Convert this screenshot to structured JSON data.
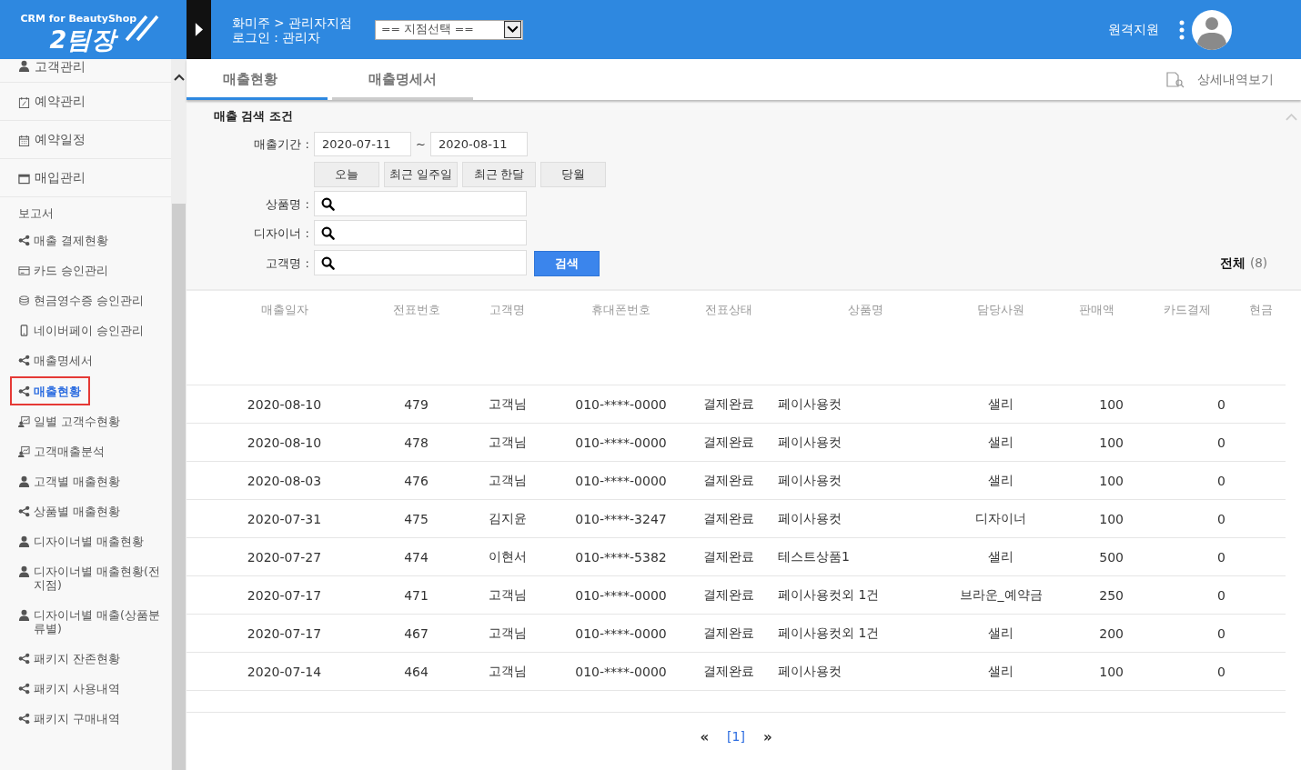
{
  "header": {
    "logo": {
      "tagline": "CRM for BeautyShop",
      "name": "2팀장"
    },
    "breadcrumb": "화미주 > 관리자지점",
    "login": "로그인 : 관리자",
    "branch_select": {
      "value": "== 지점선택 =="
    },
    "remote_support": "원격지원"
  },
  "sidebar": {
    "items": [
      {
        "kind": "item",
        "label": "고객관리",
        "selected": false
      },
      {
        "kind": "item",
        "label": "예약관리",
        "selected": false
      },
      {
        "kind": "item",
        "label": "예약일정",
        "selected": false
      },
      {
        "kind": "item",
        "label": "매입관리",
        "selected": false
      },
      {
        "kind": "section",
        "label": "보고서"
      },
      {
        "kind": "sub",
        "label": "매출 결제현황",
        "selected": false
      },
      {
        "kind": "sub",
        "label": "카드 승인관리",
        "selected": false
      },
      {
        "kind": "sub",
        "label": "현금영수증 승인관리",
        "selected": false
      },
      {
        "kind": "sub",
        "label": "네이버페이 승인관리",
        "selected": false
      },
      {
        "kind": "sub",
        "label": "매출명세서",
        "selected": false
      },
      {
        "kind": "sub",
        "label": "매출현황",
        "selected": true
      },
      {
        "kind": "sub",
        "label": "일별 고객수현황",
        "selected": false
      },
      {
        "kind": "sub",
        "label": "고객매출분석",
        "selected": false
      },
      {
        "kind": "sub",
        "label": "고객별 매출현황",
        "selected": false
      },
      {
        "kind": "sub",
        "label": "상품별 매출현황",
        "selected": false
      },
      {
        "kind": "sub",
        "label": "디자이너별 매출현황",
        "selected": false
      },
      {
        "kind": "sub",
        "label": "디자이너별 매출현황(전지점)",
        "selected": false
      },
      {
        "kind": "sub",
        "label": "디자이너별 매출(상품분류별)",
        "selected": false
      },
      {
        "kind": "sub",
        "label": "패키지 잔존현황",
        "selected": false
      },
      {
        "kind": "sub",
        "label": "패키지 사용내역",
        "selected": false
      },
      {
        "kind": "sub",
        "label": "패키지 구매내역",
        "selected": false
      }
    ]
  },
  "tabs": [
    {
      "label": "매출현황",
      "selected": true
    },
    {
      "label": "매출명세서",
      "selected": false
    }
  ],
  "detail_link": "상세내역보기",
  "search": {
    "title": "매출 검색 조건",
    "period": {
      "label": "매출기간 :",
      "from": "2020-07-11",
      "separator": "~",
      "to": "2020-08-11"
    },
    "quick_buttons": [
      "오늘",
      "최근 일주일",
      "최근 한달",
      "당월"
    ],
    "fields": [
      {
        "label": "상품명 :"
      },
      {
        "label": "디자이너 :"
      },
      {
        "label": "고객명 :"
      }
    ],
    "search_button": "검색",
    "total": {
      "label": "전체",
      "count": "(8)"
    }
  },
  "table": {
    "columns": [
      "매출일자",
      "전표번호",
      "고객명",
      "휴대폰번호",
      "전표상태",
      "상품명",
      "담당사원",
      "판매액",
      "카드결제",
      "현금"
    ],
    "rows": [
      [
        "2020-08-10",
        "479",
        "고객님",
        "010-****-0000",
        "결제완료",
        "페이사용컷",
        "샐리",
        "100",
        "0"
      ],
      [
        "2020-08-10",
        "478",
        "고객님",
        "010-****-0000",
        "결제완료",
        "페이사용컷",
        "샐리",
        "100",
        "0"
      ],
      [
        "2020-08-03",
        "476",
        "고객님",
        "010-****-0000",
        "결제완료",
        "페이사용컷",
        "샐리",
        "100",
        "0"
      ],
      [
        "2020-07-31",
        "475",
        "김지윤",
        "010-****-3247",
        "결제완료",
        "페이사용컷",
        "디자이너",
        "100",
        "0"
      ],
      [
        "2020-07-27",
        "474",
        "이현서",
        "010-****-5382",
        "결제완료",
        "테스트상품1",
        "샐리",
        "500",
        "0"
      ],
      [
        "2020-07-17",
        "471",
        "고객님",
        "010-****-0000",
        "결제완료",
        "페이사용컷외 1건",
        "브라운_예약금",
        "250",
        "0"
      ],
      [
        "2020-07-17",
        "467",
        "고객님",
        "010-****-0000",
        "결제완료",
        "페이사용컷외 1건",
        "샐리",
        "200",
        "0"
      ],
      [
        "2020-07-14",
        "464",
        "고객님",
        "010-****-0000",
        "결제완료",
        "페이사용컷",
        "샐리",
        "100",
        "0"
      ]
    ]
  },
  "pagination": {
    "prev": "«",
    "page": "[1]",
    "next": "»"
  }
}
